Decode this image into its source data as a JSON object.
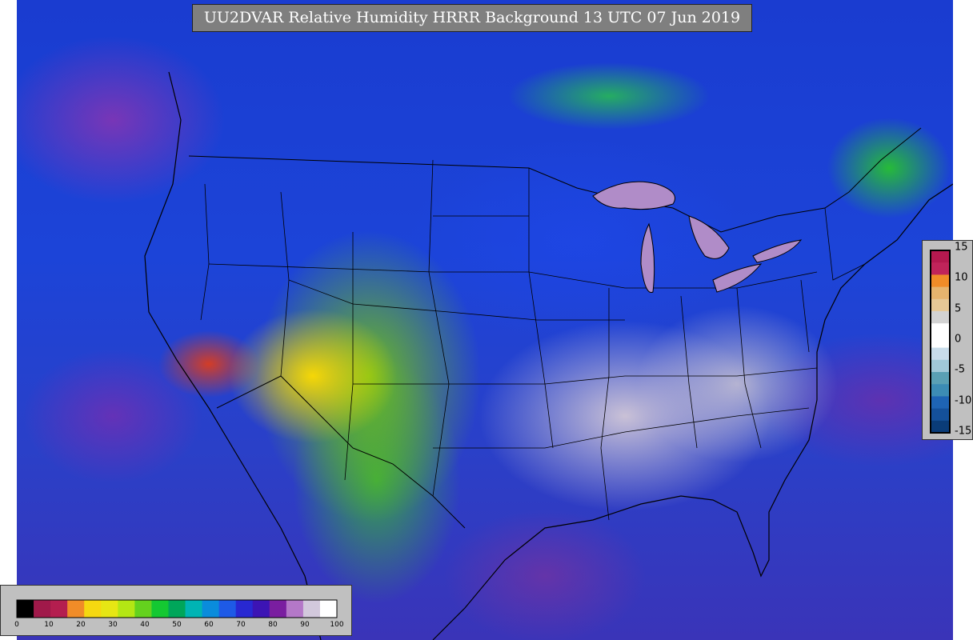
{
  "title": "UU2DVAR Relative Humidity HRRR Background  13 UTC 07 Jun 2019",
  "colorbar_bottom": {
    "ticks": [
      "0",
      "10",
      "20",
      "30",
      "40",
      "50",
      "60",
      "70",
      "80",
      "90",
      "100"
    ],
    "bins": [
      {
        "color": "#000000"
      },
      {
        "color": "#a0194a"
      },
      {
        "color": "#b41e4f"
      },
      {
        "color": "#f08c28"
      },
      {
        "color": "#f5d810"
      },
      {
        "color": "#e6e614"
      },
      {
        "color": "#b4e614"
      },
      {
        "color": "#64d21e"
      },
      {
        "color": "#14c832"
      },
      {
        "color": "#00a65a"
      },
      {
        "color": "#00b4b4"
      },
      {
        "color": "#0a8cdc"
      },
      {
        "color": "#1e5ae6"
      },
      {
        "color": "#2828d2"
      },
      {
        "color": "#3c14b4"
      },
      {
        "color": "#7a1ea0"
      },
      {
        "color": "#b478c8"
      },
      {
        "color": "#d2c8dc"
      },
      {
        "color": "#ffffff"
      }
    ]
  },
  "colorbar_right": {
    "ticks": [
      "15",
      "10",
      "5",
      "0",
      "-5",
      "-10",
      "-15"
    ],
    "bins": [
      {
        "color": "#b4194f"
      },
      {
        "color": "#c0245a"
      },
      {
        "color": "#f08c28"
      },
      {
        "color": "#e6b46e"
      },
      {
        "color": "#e6c896"
      },
      {
        "color": "#d2d2d2"
      },
      {
        "color": "#ffffff"
      },
      {
        "color": "#ffffff"
      },
      {
        "color": "#c8dcea"
      },
      {
        "color": "#a0c8d8"
      },
      {
        "color": "#5aa0b4"
      },
      {
        "color": "#3c8cb4"
      },
      {
        "color": "#1e64b4"
      },
      {
        "color": "#14509a"
      },
      {
        "color": "#0a3c78"
      }
    ]
  },
  "colors": {
    "title_bg": "#7f7f7f",
    "panel_bg": "#c0c0c0"
  }
}
